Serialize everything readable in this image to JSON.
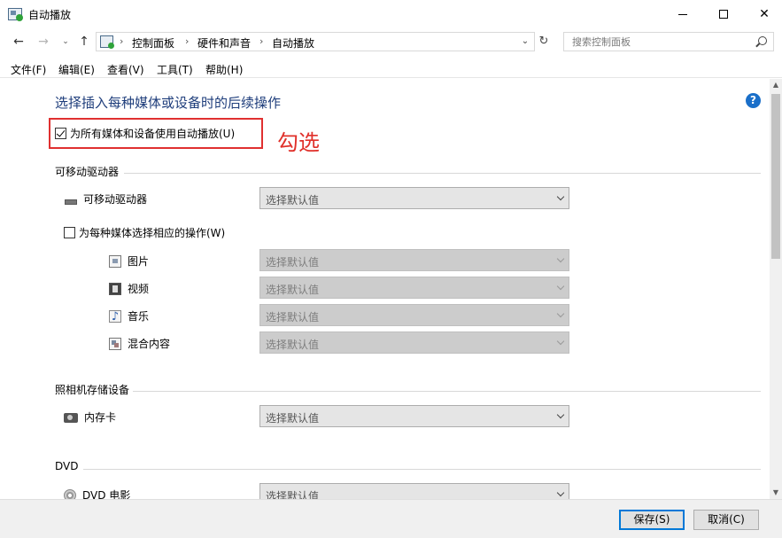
{
  "window": {
    "title": "自动播放",
    "minimize": "—",
    "close": "✕"
  },
  "nav": {
    "back": "←",
    "forward": "→",
    "recent": "⌄",
    "up": "↑",
    "breadcrumbs": [
      "控制面板",
      "硬件和声音",
      "自动播放"
    ],
    "separator": "›",
    "dropdown": "⌄",
    "refresh": "↻"
  },
  "search": {
    "placeholder": "搜索控制面板"
  },
  "menu": [
    "文件(F)",
    "编辑(E)",
    "查看(V)",
    "工具(T)",
    "帮助(H)"
  ],
  "main": {
    "heading": "选择插入每种媒体或设备时的后续操作",
    "help": "?",
    "autoplay_all": {
      "label": "为所有媒体和设备使用自动播放(U)",
      "checked": true
    },
    "annotation": "勾选",
    "sections": {
      "removable": {
        "title": "可移动驱动器",
        "device_label": "可移动驱动器",
        "device_value": "选择默认值",
        "per_media": {
          "label": "为每种媒体选择相应的操作(W)",
          "checked": false
        },
        "media": [
          {
            "label": "图片",
            "value": "选择默认值"
          },
          {
            "label": "视频",
            "value": "选择默认值"
          },
          {
            "label": "音乐",
            "value": "选择默认值"
          },
          {
            "label": "混合内容",
            "value": "选择默认值"
          }
        ]
      },
      "camera": {
        "title": "照相机存储设备",
        "device_label": "内存卡",
        "device_value": "选择默认值"
      },
      "dvd": {
        "title": "DVD",
        "device_label": "DVD 电影",
        "device_value": "选择默认值"
      }
    }
  },
  "scroll": {
    "up": "▲",
    "down": "▼"
  },
  "footer": {
    "save": "保存(S)",
    "cancel": "取消(C)"
  },
  "colors": {
    "heading": "#1e3d7b",
    "highlight": "#e03030",
    "annotation": "#e0302a",
    "help": "#1a6fc9",
    "accent": "#0078d7"
  }
}
